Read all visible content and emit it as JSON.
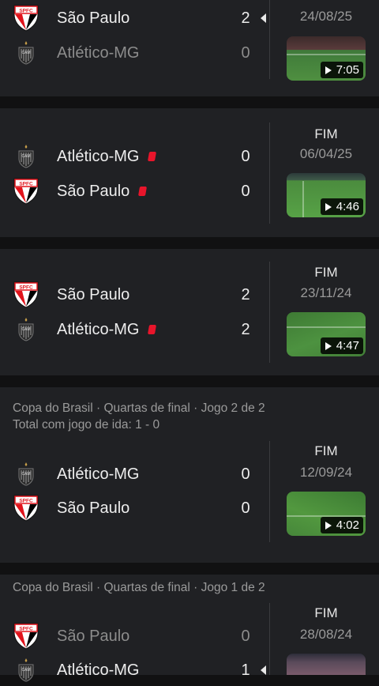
{
  "teams": {
    "spfc": "São Paulo",
    "cam": "Atlético-MG",
    "spfc_crest_text": "SPFC",
    "cam_crest_text": "CAM"
  },
  "matches": [
    {
      "status": "",
      "date": "24/08/25",
      "duration": "7:05",
      "rows": [
        {
          "team": "São Paulo",
          "score": "2",
          "winner": true
        },
        {
          "team": "Atlético-MG",
          "score": "0",
          "winner": false
        }
      ]
    },
    {
      "status": "FIM",
      "date": "06/04/25",
      "duration": "4:46",
      "rows": [
        {
          "team": "Atlético-MG",
          "score": "0",
          "red_card": true
        },
        {
          "team": "São Paulo",
          "score": "0",
          "red_card": true
        }
      ]
    },
    {
      "status": "FIM",
      "date": "23/11/24",
      "duration": "4:47",
      "rows": [
        {
          "team": "São Paulo",
          "score": "2"
        },
        {
          "team": "Atlético-MG",
          "score": "2",
          "red_card": true
        }
      ]
    },
    {
      "header": "Copa do Brasil · Quartas de final · Jogo 2 de 2",
      "subheader": "Total com jogo de ida: 1 - 0",
      "status": "FIM",
      "date": "12/09/24",
      "duration": "4:02",
      "rows": [
        {
          "team": "Atlético-MG",
          "score": "0"
        },
        {
          "team": "São Paulo",
          "score": "0"
        }
      ]
    },
    {
      "header": "Copa do Brasil · Quartas de final · Jogo 1 de 2",
      "status": "FIM",
      "date": "28/08/24",
      "rows": [
        {
          "team": "São Paulo",
          "score": "0",
          "winner": false
        },
        {
          "team": "Atlético-MG",
          "score": "1",
          "winner": true
        }
      ]
    }
  ],
  "colors": {
    "background": "#111112",
    "card": "#202124",
    "red_card": "#e8152b",
    "spfc_red": "#e1141c"
  }
}
